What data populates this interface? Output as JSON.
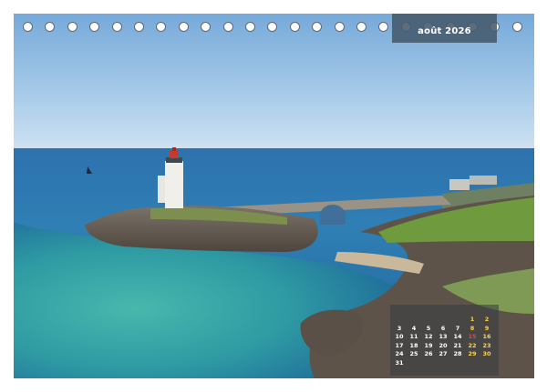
{
  "month_label": "août 2026",
  "calendar": {
    "weeks": [
      [
        "",
        "",
        "",
        "",
        "",
        "1",
        "2"
      ],
      [
        "3",
        "4",
        "5",
        "6",
        "7",
        "8",
        "9"
      ],
      [
        "10",
        "11",
        "12",
        "13",
        "14",
        "15",
        "16"
      ],
      [
        "17",
        "18",
        "19",
        "20",
        "21",
        "22",
        "23"
      ],
      [
        "24",
        "25",
        "26",
        "27",
        "28",
        "29",
        "30"
      ],
      [
        "31",
        "",
        "",
        "",
        "",
        "",
        ""
      ]
    ],
    "holiday": "15",
    "weekday_color": "#ffffff",
    "weekend_color": "#ffd24a",
    "holiday_color": "#ff3b3b"
  },
  "colors": {
    "banner": "#465a6c",
    "sky_top": "#7fb3df",
    "sea_deep": "#2a6fa8",
    "lagoon": "#3aa9a4"
  },
  "binding_hole_count": 23
}
